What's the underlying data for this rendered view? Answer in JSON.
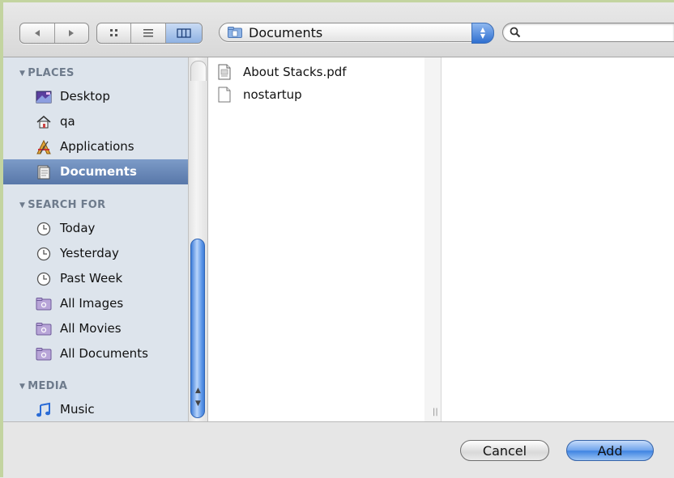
{
  "toolbar": {
    "nav_back_icon": "triangle-left",
    "nav_forward_icon": "triangle-right",
    "view_icon_label": "icon-view",
    "view_list_label": "list-view",
    "view_column_label": "column-view",
    "path_popup_value": "Documents",
    "search_placeholder": "",
    "accent_color": "#3d83e2"
  },
  "sidebar": {
    "sections": [
      {
        "header": "PLACES",
        "items": [
          {
            "label": "Desktop",
            "icon": "desktop-icon"
          },
          {
            "label": "qa",
            "icon": "home-icon"
          },
          {
            "label": "Applications",
            "icon": "applications-icon"
          },
          {
            "label": "Documents",
            "icon": "documents-folder-icon",
            "selected": true
          }
        ]
      },
      {
        "header": "SEARCH FOR",
        "items": [
          {
            "label": "Today",
            "icon": "clock-icon"
          },
          {
            "label": "Yesterday",
            "icon": "clock-icon"
          },
          {
            "label": "Past Week",
            "icon": "clock-icon"
          },
          {
            "label": "All Images",
            "icon": "smart-folder-icon"
          },
          {
            "label": "All Movies",
            "icon": "smart-folder-icon"
          },
          {
            "label": "All Documents",
            "icon": "smart-folder-icon"
          }
        ]
      },
      {
        "header": "MEDIA",
        "items": [
          {
            "label": "Music",
            "icon": "music-note-icon"
          }
        ]
      }
    ],
    "selected_color": "#5877a9"
  },
  "files": [
    {
      "name": "About Stacks.pdf",
      "icon": "pdf-document-icon"
    },
    {
      "name": "nostartup",
      "icon": "blank-document-icon"
    }
  ],
  "buttons": {
    "cancel_label": "Cancel",
    "add_label": "Add"
  }
}
